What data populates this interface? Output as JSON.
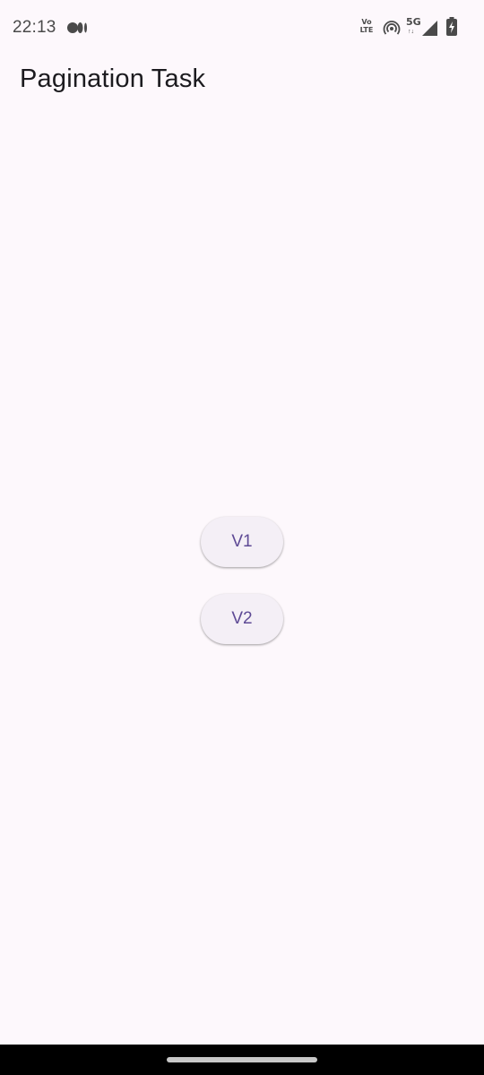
{
  "status_bar": {
    "time": "22:13",
    "volte_top": "Vo",
    "volte_bottom": "LTE",
    "network": "5G",
    "network_arrows": "↑↓",
    "icons": [
      "app-notification-icon",
      "volte-icon",
      "hotspot-icon",
      "signal-icon",
      "battery-icon"
    ]
  },
  "app_bar": {
    "title": "Pagination Task"
  },
  "buttons": {
    "v1_label": "V1",
    "v2_label": "V2"
  },
  "colors": {
    "background": "#fdf8fc",
    "button_bg": "#f4eff6",
    "button_text": "#5e4a95",
    "title_text": "#1c1b1f"
  }
}
